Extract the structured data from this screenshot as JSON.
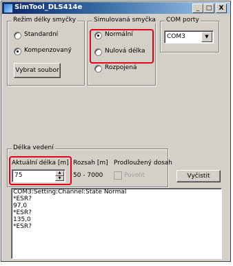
{
  "window": {
    "title": "SimTool_DLS414e",
    "minimize": "_",
    "maximize": "□",
    "close": "X"
  },
  "loop_mode": {
    "label": "Režim délky smyčky",
    "options": [
      {
        "label": "Standardní",
        "selected": false
      },
      {
        "label": "Kompenzovaný",
        "selected": true
      }
    ],
    "choose_file_button": "Vybrat soubor"
  },
  "simulated_loop": {
    "label": "Simulovaná smyčka",
    "options": [
      {
        "label": "Normální",
        "selected": true
      },
      {
        "label": "Nulová délka",
        "selected": false
      },
      {
        "label": "Rozpojená",
        "selected": false
      }
    ]
  },
  "com_ports": {
    "label": "COM porty",
    "selected": "COM3"
  },
  "line_length": {
    "label": "Délka vedení",
    "current_label": "Aktuální délka [m]",
    "current_value": "75",
    "range_label": "Rozsah [m]",
    "range_value": "50 - 7000",
    "extended_label": "Prodloužený dosah",
    "allow_label": "Povolit",
    "allow_checked": false
  },
  "clear_button": "Vyčistit",
  "log": [
    "COM3:Setting:Channel:State Normal",
    "*ESR?",
    "97,0",
    "*ESR?",
    "135,0",
    "*ESR?"
  ],
  "colors": {
    "highlight": "#e3001b",
    "face": "#d4d0c8",
    "title_start": "#0a246a",
    "title_end": "#a6caf0"
  }
}
